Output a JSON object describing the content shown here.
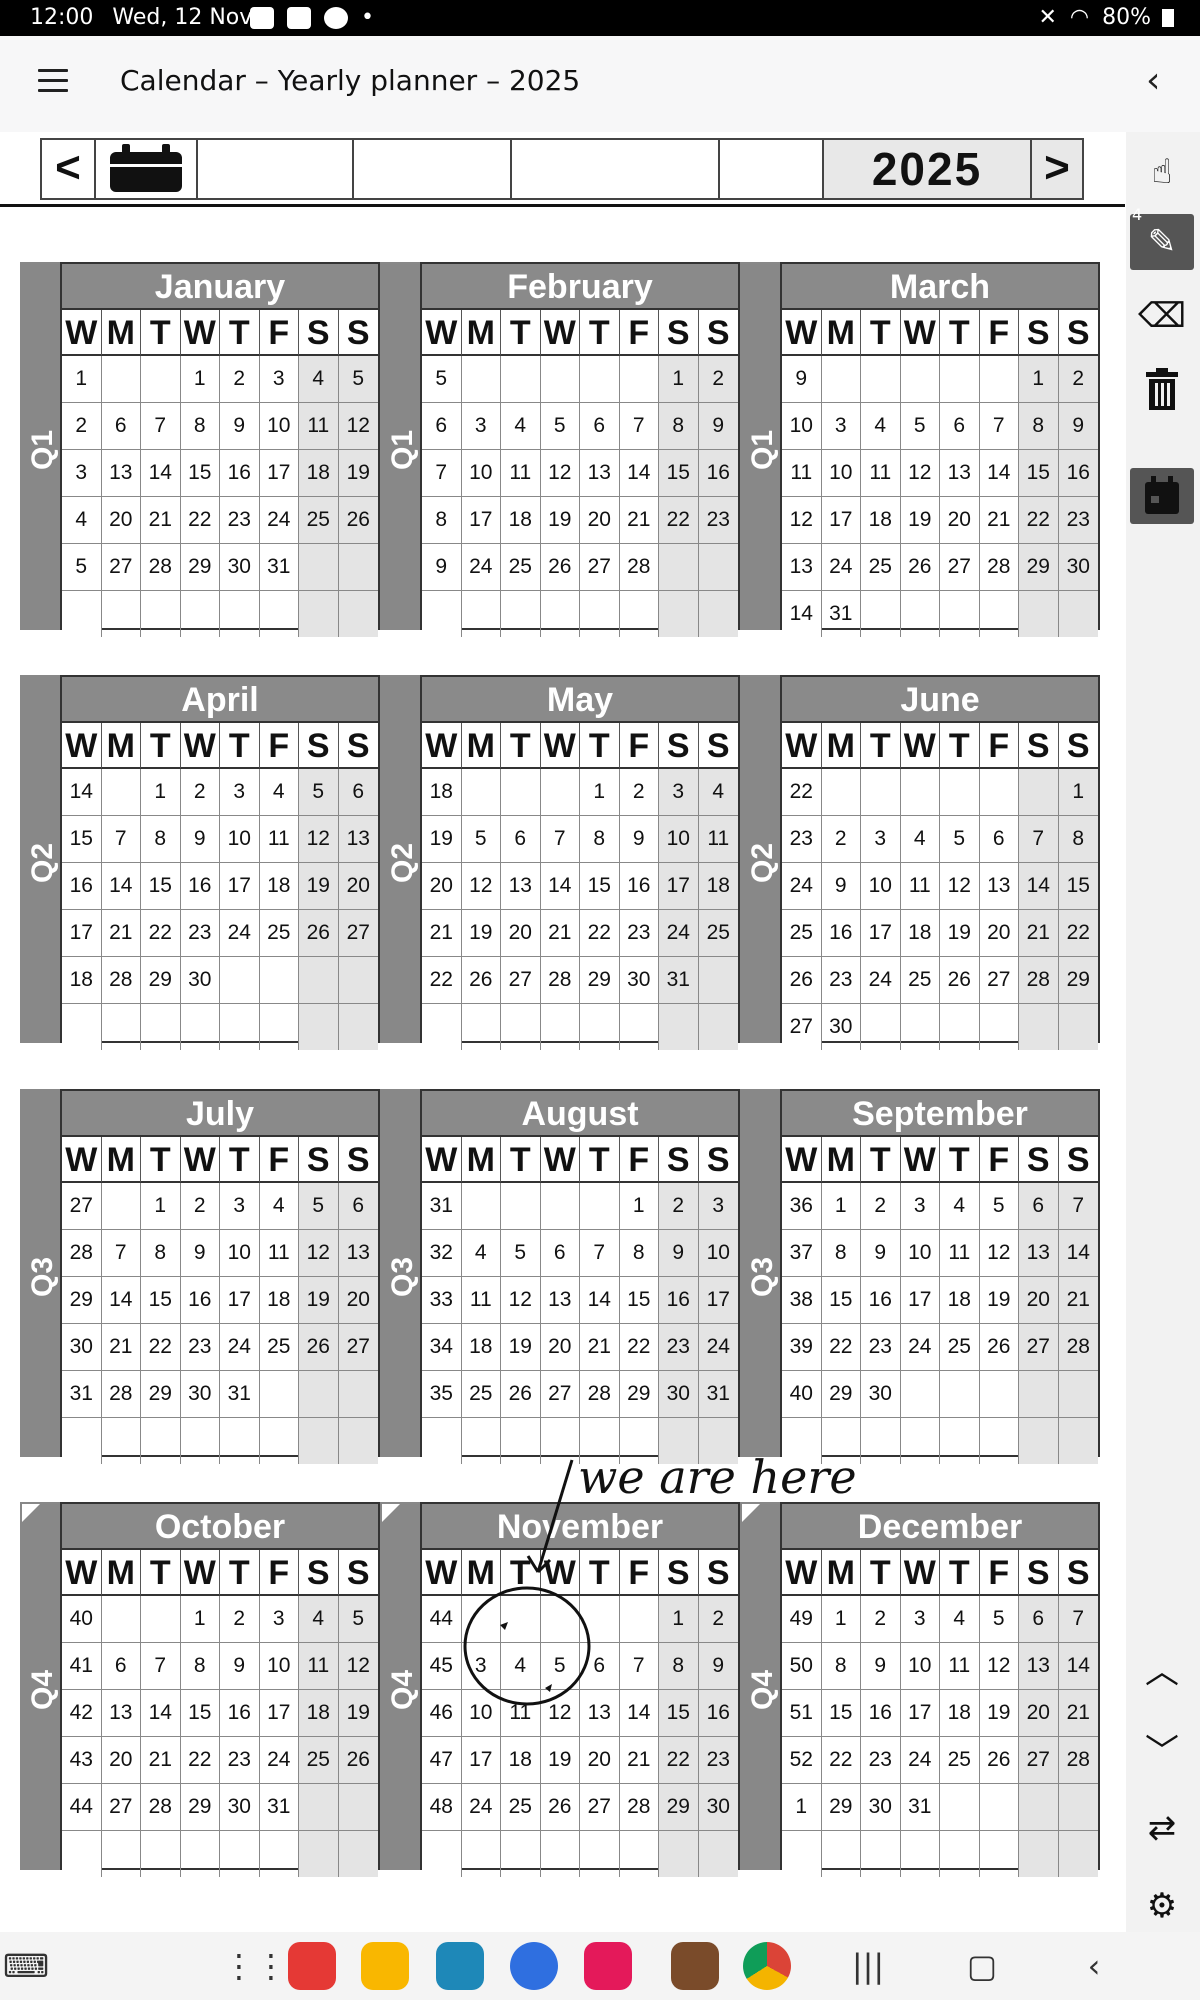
{
  "status": {
    "time": "12:00",
    "date": "Wed, 12 Nov",
    "dot": "•",
    "battery": "80%"
  },
  "appbar": {
    "title": "Calendar – Yearly planner – 2025",
    "back": "‹"
  },
  "toolbar": {
    "prev": "<",
    "next": ">",
    "year": "2025"
  },
  "rail": {
    "pen_badge": "4"
  },
  "dow": [
    "W",
    "M",
    "T",
    "W",
    "T",
    "F",
    "S",
    "S"
  ],
  "annotation": {
    "handwritten_text": "we are here"
  },
  "quarters": [
    "Q1",
    "Q2",
    "Q3",
    "Q4"
  ],
  "months": [
    {
      "name": "January",
      "rows": [
        [
          "1",
          "",
          "",
          "1",
          "2",
          "3",
          "4",
          "5"
        ],
        [
          "2",
          "6",
          "7",
          "8",
          "9",
          "10",
          "11",
          "12"
        ],
        [
          "3",
          "13",
          "14",
          "15",
          "16",
          "17",
          "18",
          "19"
        ],
        [
          "4",
          "20",
          "21",
          "22",
          "23",
          "24",
          "25",
          "26"
        ],
        [
          "5",
          "27",
          "28",
          "29",
          "30",
          "31",
          "",
          ""
        ],
        [
          "",
          "",
          "",
          "",
          "",
          "",
          "",
          ""
        ]
      ]
    },
    {
      "name": "February",
      "rows": [
        [
          "5",
          "",
          "",
          "",
          "",
          "",
          "1",
          "2"
        ],
        [
          "6",
          "3",
          "4",
          "5",
          "6",
          "7",
          "8",
          "9"
        ],
        [
          "7",
          "10",
          "11",
          "12",
          "13",
          "14",
          "15",
          "16"
        ],
        [
          "8",
          "17",
          "18",
          "19",
          "20",
          "21",
          "22",
          "23"
        ],
        [
          "9",
          "24",
          "25",
          "26",
          "27",
          "28",
          "",
          ""
        ],
        [
          "",
          "",
          "",
          "",
          "",
          "",
          "",
          ""
        ]
      ]
    },
    {
      "name": "March",
      "rows": [
        [
          "9",
          "",
          "",
          "",
          "",
          "",
          "1",
          "2"
        ],
        [
          "10",
          "3",
          "4",
          "5",
          "6",
          "7",
          "8",
          "9"
        ],
        [
          "11",
          "10",
          "11",
          "12",
          "13",
          "14",
          "15",
          "16"
        ],
        [
          "12",
          "17",
          "18",
          "19",
          "20",
          "21",
          "22",
          "23"
        ],
        [
          "13",
          "24",
          "25",
          "26",
          "27",
          "28",
          "29",
          "30"
        ],
        [
          "14",
          "31",
          "",
          "",
          "",
          "",
          "",
          ""
        ]
      ]
    },
    {
      "name": "April",
      "rows": [
        [
          "14",
          "",
          "1",
          "2",
          "3",
          "4",
          "5",
          "6"
        ],
        [
          "15",
          "7",
          "8",
          "9",
          "10",
          "11",
          "12",
          "13"
        ],
        [
          "16",
          "14",
          "15",
          "16",
          "17",
          "18",
          "19",
          "20"
        ],
        [
          "17",
          "21",
          "22",
          "23",
          "24",
          "25",
          "26",
          "27"
        ],
        [
          "18",
          "28",
          "29",
          "30",
          "",
          "",
          "",
          ""
        ],
        [
          "",
          "",
          "",
          "",
          "",
          "",
          "",
          ""
        ]
      ]
    },
    {
      "name": "May",
      "rows": [
        [
          "18",
          "",
          "",
          "",
          "1",
          "2",
          "3",
          "4"
        ],
        [
          "19",
          "5",
          "6",
          "7",
          "8",
          "9",
          "10",
          "11"
        ],
        [
          "20",
          "12",
          "13",
          "14",
          "15",
          "16",
          "17",
          "18"
        ],
        [
          "21",
          "19",
          "20",
          "21",
          "22",
          "23",
          "24",
          "25"
        ],
        [
          "22",
          "26",
          "27",
          "28",
          "29",
          "30",
          "31",
          ""
        ],
        [
          "",
          "",
          "",
          "",
          "",
          "",
          "",
          ""
        ]
      ]
    },
    {
      "name": "June",
      "rows": [
        [
          "22",
          "",
          "",
          "",
          "",
          "",
          "",
          "1"
        ],
        [
          "23",
          "2",
          "3",
          "4",
          "5",
          "6",
          "7",
          "8"
        ],
        [
          "24",
          "9",
          "10",
          "11",
          "12",
          "13",
          "14",
          "15"
        ],
        [
          "25",
          "16",
          "17",
          "18",
          "19",
          "20",
          "21",
          "22"
        ],
        [
          "26",
          "23",
          "24",
          "25",
          "26",
          "27",
          "28",
          "29"
        ],
        [
          "27",
          "30",
          "",
          "",
          "",
          "",
          "",
          ""
        ]
      ]
    },
    {
      "name": "July",
      "rows": [
        [
          "27",
          "",
          "1",
          "2",
          "3",
          "4",
          "5",
          "6"
        ],
        [
          "28",
          "7",
          "8",
          "9",
          "10",
          "11",
          "12",
          "13"
        ],
        [
          "29",
          "14",
          "15",
          "16",
          "17",
          "18",
          "19",
          "20"
        ],
        [
          "30",
          "21",
          "22",
          "23",
          "24",
          "25",
          "26",
          "27"
        ],
        [
          "31",
          "28",
          "29",
          "30",
          "31",
          "",
          "",
          ""
        ],
        [
          "",
          "",
          "",
          "",
          "",
          "",
          "",
          ""
        ]
      ]
    },
    {
      "name": "August",
      "rows": [
        [
          "31",
          "",
          "",
          "",
          "",
          "1",
          "2",
          "3"
        ],
        [
          "32",
          "4",
          "5",
          "6",
          "7",
          "8",
          "9",
          "10"
        ],
        [
          "33",
          "11",
          "12",
          "13",
          "14",
          "15",
          "16",
          "17"
        ],
        [
          "34",
          "18",
          "19",
          "20",
          "21",
          "22",
          "23",
          "24"
        ],
        [
          "35",
          "25",
          "26",
          "27",
          "28",
          "29",
          "30",
          "31"
        ],
        [
          "",
          "",
          "",
          "",
          "",
          "",
          "",
          ""
        ]
      ]
    },
    {
      "name": "September",
      "rows": [
        [
          "36",
          "1",
          "2",
          "3",
          "4",
          "5",
          "6",
          "7"
        ],
        [
          "37",
          "8",
          "9",
          "10",
          "11",
          "12",
          "13",
          "14"
        ],
        [
          "38",
          "15",
          "16",
          "17",
          "18",
          "19",
          "20",
          "21"
        ],
        [
          "39",
          "22",
          "23",
          "24",
          "25",
          "26",
          "27",
          "28"
        ],
        [
          "40",
          "29",
          "30",
          "",
          "",
          "",
          "",
          ""
        ],
        [
          "",
          "",
          "",
          "",
          "",
          "",
          "",
          ""
        ]
      ]
    },
    {
      "name": "October",
      "rows": [
        [
          "40",
          "",
          "",
          "1",
          "2",
          "3",
          "4",
          "5"
        ],
        [
          "41",
          "6",
          "7",
          "8",
          "9",
          "10",
          "11",
          "12"
        ],
        [
          "42",
          "13",
          "14",
          "15",
          "16",
          "17",
          "18",
          "19"
        ],
        [
          "43",
          "20",
          "21",
          "22",
          "23",
          "24",
          "25",
          "26"
        ],
        [
          "44",
          "27",
          "28",
          "29",
          "30",
          "31",
          "",
          ""
        ],
        [
          "",
          "",
          "",
          "",
          "",
          "",
          "",
          ""
        ]
      ]
    },
    {
      "name": "November",
      "rows": [
        [
          "44",
          "",
          "",
          "",
          "",
          "",
          "1",
          "2"
        ],
        [
          "45",
          "3",
          "4",
          "5",
          "6",
          "7",
          "8",
          "9"
        ],
        [
          "46",
          "10",
          "11",
          "12",
          "13",
          "14",
          "15",
          "16"
        ],
        [
          "47",
          "17",
          "18",
          "19",
          "20",
          "21",
          "22",
          "23"
        ],
        [
          "48",
          "24",
          "25",
          "26",
          "27",
          "28",
          "29",
          "30"
        ],
        [
          "",
          "",
          "",
          "",
          "",
          "",
          "",
          ""
        ]
      ]
    },
    {
      "name": "December",
      "rows": [
        [
          "49",
          "1",
          "2",
          "3",
          "4",
          "5",
          "6",
          "7"
        ],
        [
          "50",
          "8",
          "9",
          "10",
          "11",
          "12",
          "13",
          "14"
        ],
        [
          "51",
          "15",
          "16",
          "17",
          "18",
          "19",
          "20",
          "21"
        ],
        [
          "52",
          "22",
          "23",
          "24",
          "25",
          "26",
          "27",
          "28"
        ],
        [
          "1",
          "29",
          "30",
          "31",
          "",
          "",
          "",
          ""
        ],
        [
          "",
          "",
          "",
          "",
          "",
          "",
          "",
          ""
        ]
      ]
    }
  ]
}
